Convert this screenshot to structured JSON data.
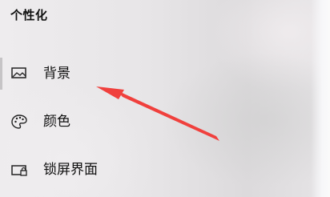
{
  "section_title": "个性化",
  "nav": {
    "items": [
      {
        "label": "背景",
        "icon": "image-icon"
      },
      {
        "label": "颜色",
        "icon": "palette-icon"
      },
      {
        "label": "锁屏界面",
        "icon": "lock-screen-icon"
      }
    ]
  },
  "accent_colors": {
    "arrow": "#f0403d"
  }
}
